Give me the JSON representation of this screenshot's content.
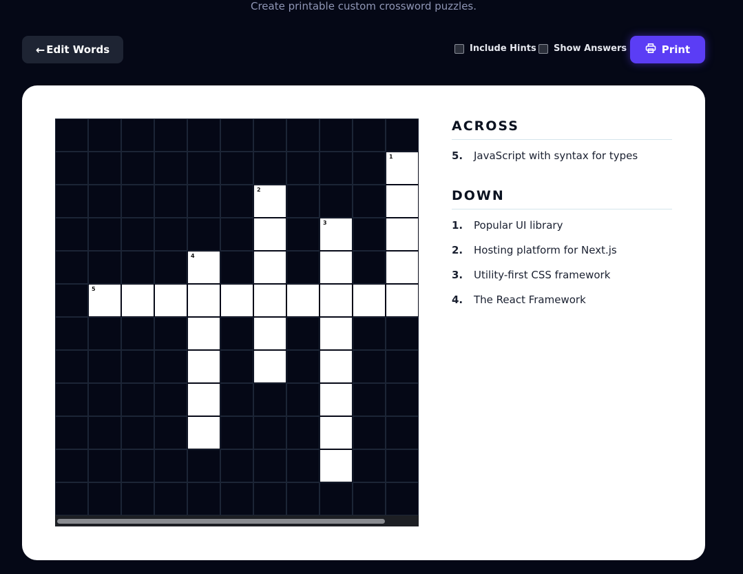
{
  "subtitle": "Create printable custom crossword puzzles.",
  "toolbar": {
    "edit_label": "Edit Words",
    "edit_arrow": "←",
    "include_hints_label": "Include Hints",
    "show_answers_label": "Show Answers",
    "print_label": "Print",
    "print_icon": "printer-icon",
    "accent_color": "#5b3df5"
  },
  "grid": {
    "rows": 12,
    "cols": 11,
    "white_cells": [
      [
        1,
        10
      ],
      [
        2,
        6
      ],
      [
        2,
        10
      ],
      [
        3,
        6
      ],
      [
        3,
        8
      ],
      [
        3,
        10
      ],
      [
        4,
        4
      ],
      [
        4,
        6
      ],
      [
        4,
        8
      ],
      [
        4,
        10
      ],
      [
        5,
        1
      ],
      [
        5,
        2
      ],
      [
        5,
        3
      ],
      [
        5,
        4
      ],
      [
        5,
        5
      ],
      [
        5,
        6
      ],
      [
        5,
        7
      ],
      [
        5,
        8
      ],
      [
        5,
        9
      ],
      [
        5,
        10
      ],
      [
        6,
        4
      ],
      [
        6,
        6
      ],
      [
        6,
        8
      ],
      [
        7,
        4
      ],
      [
        7,
        6
      ],
      [
        7,
        8
      ],
      [
        8,
        4
      ],
      [
        8,
        8
      ],
      [
        9,
        4
      ],
      [
        9,
        8
      ],
      [
        10,
        8
      ]
    ],
    "numbers": [
      {
        "r": 1,
        "c": 10,
        "n": "1"
      },
      {
        "r": 2,
        "c": 6,
        "n": "2"
      },
      {
        "r": 3,
        "c": 8,
        "n": "3"
      },
      {
        "r": 4,
        "c": 4,
        "n": "4"
      },
      {
        "r": 5,
        "c": 1,
        "n": "5"
      }
    ]
  },
  "clues": {
    "across_heading": "ACROSS",
    "down_heading": "DOWN",
    "across": [
      {
        "num": "5.",
        "text": "JavaScript with syntax for types"
      }
    ],
    "down": [
      {
        "num": "1.",
        "text": "Popular UI library"
      },
      {
        "num": "2.",
        "text": "Hosting platform for Next.js"
      },
      {
        "num": "3.",
        "text": "Utility-first CSS framework"
      },
      {
        "num": "4.",
        "text": "The React Framework"
      }
    ]
  }
}
